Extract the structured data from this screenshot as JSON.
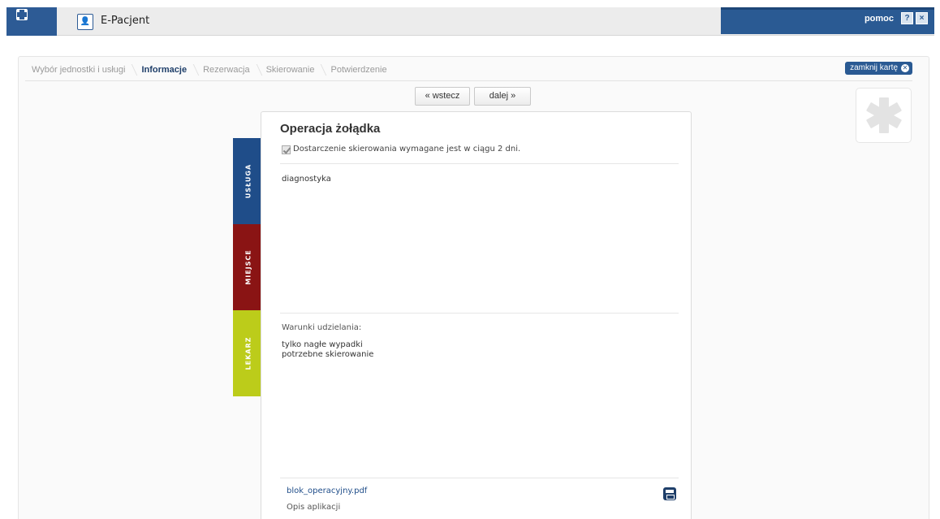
{
  "app": {
    "title": "E-Pacjent",
    "help_link": "pomoc",
    "help_button": "?",
    "close_button": "×"
  },
  "breadcrumb": {
    "items": [
      {
        "label": "Wybór jednostki i usługi",
        "active": false
      },
      {
        "label": "Informacje",
        "active": true
      },
      {
        "label": "Rezerwacja",
        "active": false
      },
      {
        "label": "Skierowanie",
        "active": false
      },
      {
        "label": "Potwierdzenie",
        "active": false
      }
    ],
    "close_card": "zamknij kartę"
  },
  "nav": {
    "back": "« wstecz",
    "next": "dalej »"
  },
  "tabs": [
    {
      "label": "USŁUGA",
      "color": "#1f4d89"
    },
    {
      "label": "MIEJSCE",
      "color": "#8a1414"
    },
    {
      "label": "LEKARZ",
      "color": "#bccc1a"
    }
  ],
  "service": {
    "title": "Operacja żołądka",
    "referral_required_label": "Dostarczenie skierowania wymagane jest w ciągu 2 dni.",
    "referral_required_checked": true,
    "description": "diagnostyka",
    "conditions_label": "Warunki udzielania:",
    "conditions": [
      "tylko nagłe wypadki",
      "potrzebne skierowanie"
    ],
    "attachment": {
      "file_name": "blok_operacyjny.pdf",
      "description": "Opis aplikacji"
    }
  },
  "colors": {
    "primary": "#2a5a93",
    "tab_usluga": "#1f4d89",
    "tab_miejsce": "#8a1414",
    "tab_lekarz": "#bccc1a"
  }
}
